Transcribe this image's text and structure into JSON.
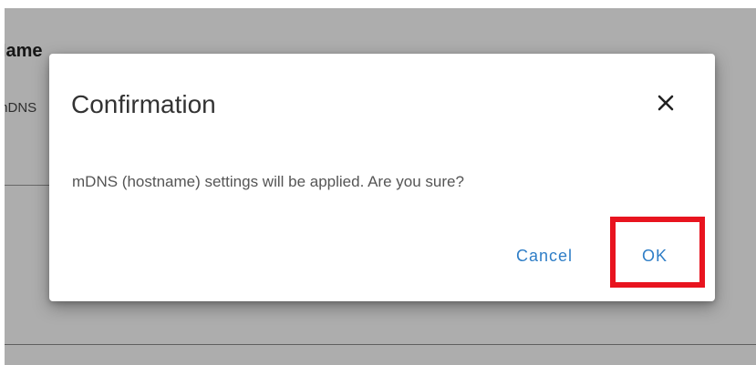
{
  "background_page": {
    "heading": "Name",
    "field_label": "mDNS"
  },
  "dialog": {
    "title": "Confirmation",
    "close_icon": "close-icon",
    "message": "mDNS (hostname) settings will be applied. Are you sure?",
    "cancel_label": "Cancel",
    "ok_label": "OK"
  },
  "colors": {
    "button_text": "#2f7ec7",
    "highlight": "#e8141f"
  }
}
